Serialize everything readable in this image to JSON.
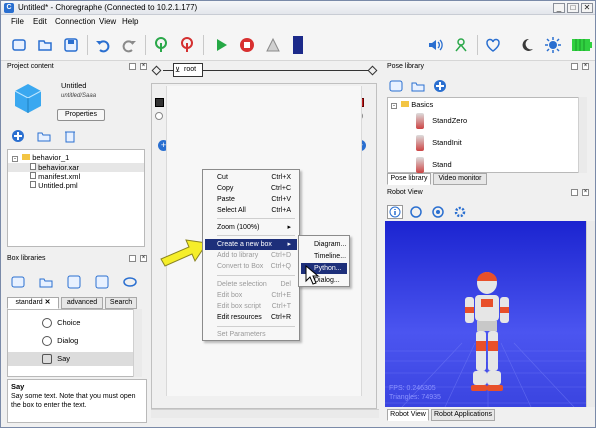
{
  "window": {
    "title": "Untitled* - Choregraphe (Connected to 10.2.1.177)",
    "app_icon": "C",
    "controls": [
      "_",
      "□",
      "✕"
    ]
  },
  "menu": [
    "File",
    "Edit",
    "Connection",
    "View",
    "Help"
  ],
  "toolbar": {
    "icons": [
      "new-icon",
      "open-icon",
      "save-icon",
      "undo-icon",
      "redo-icon",
      "connect-icon",
      "disconnect-icon",
      "play-icon",
      "stop-icon",
      "debug-icon",
      "volume-icon",
      "stiffness-icon",
      "animation-mode-icon",
      "rest-icon",
      "wake-icon",
      "battery-icon"
    ]
  },
  "project_content": {
    "header": "Project content",
    "project_name": "Untitled",
    "project_subtitle": "untitled/Saaa",
    "properties_label": "Properties",
    "tree": [
      {
        "label": "behavior_1",
        "level": 0
      },
      {
        "label": "behavior.xar",
        "level": 1,
        "selected": true
      },
      {
        "label": "manifest.xml",
        "level": 1
      },
      {
        "label": "Untitled.pml",
        "level": 1
      }
    ]
  },
  "box_libraries": {
    "header": "Box libraries",
    "tabs": [
      "standard",
      "advanced",
      "Search"
    ],
    "items": [
      "Choice",
      "Dialog",
      "Say"
    ],
    "selected": "Say",
    "description_title": "Say",
    "description": "Say some text. Note that you must open the box to enter the text."
  },
  "flow": {
    "root_label": "root"
  },
  "context_menu": {
    "items": [
      {
        "label": "Cut",
        "shortcut": "Ctrl+X",
        "disabled": false
      },
      {
        "label": "Copy",
        "shortcut": "Ctrl+C",
        "disabled": false
      },
      {
        "label": "Paste",
        "shortcut": "Ctrl+V",
        "disabled": false
      },
      {
        "label": "Select All",
        "shortcut": "Ctrl+A",
        "disabled": false
      },
      {
        "label": "Zoom (100%)",
        "shortcut": "",
        "disabled": false,
        "arrow": true
      },
      {
        "label": "Create a new box",
        "shortcut": "",
        "disabled": false,
        "arrow": true,
        "highlighted": true
      },
      {
        "label": "Add to library",
        "shortcut": "Ctrl+D",
        "disabled": true
      },
      {
        "label": "Convert to Box",
        "shortcut": "Ctrl+Q",
        "disabled": true
      },
      {
        "label": "Delete selection",
        "shortcut": "Del",
        "disabled": true
      },
      {
        "label": "Edit box",
        "shortcut": "Ctrl+E",
        "disabled": true
      },
      {
        "label": "Edit box script",
        "shortcut": "Ctrl+T",
        "disabled": true
      },
      {
        "label": "Edit resources",
        "shortcut": "Ctrl+R",
        "disabled": false
      },
      {
        "label": "Set Parameters",
        "shortcut": "",
        "disabled": true
      }
    ],
    "submenu": [
      "Diagram...",
      "Timeline...",
      "Python...",
      "Dialog..."
    ],
    "submenu_selected": "Python..."
  },
  "pose_library": {
    "header": "Pose library",
    "tree_root": "Basics",
    "poses": [
      "StandZero",
      "StandInit",
      "Stand"
    ],
    "tabs": [
      "Pose library",
      "Video monitor"
    ]
  },
  "robot_view": {
    "header": "Robot View",
    "fps": "FPS: 0.246305",
    "triangles": "Triangles: 74935",
    "tabs": [
      "Robot View",
      "Robot Applications"
    ]
  },
  "colors": {
    "highlight": "#1d2f7a",
    "robot_bg": "#2c36e0",
    "arrow": "#f5ee2a"
  }
}
